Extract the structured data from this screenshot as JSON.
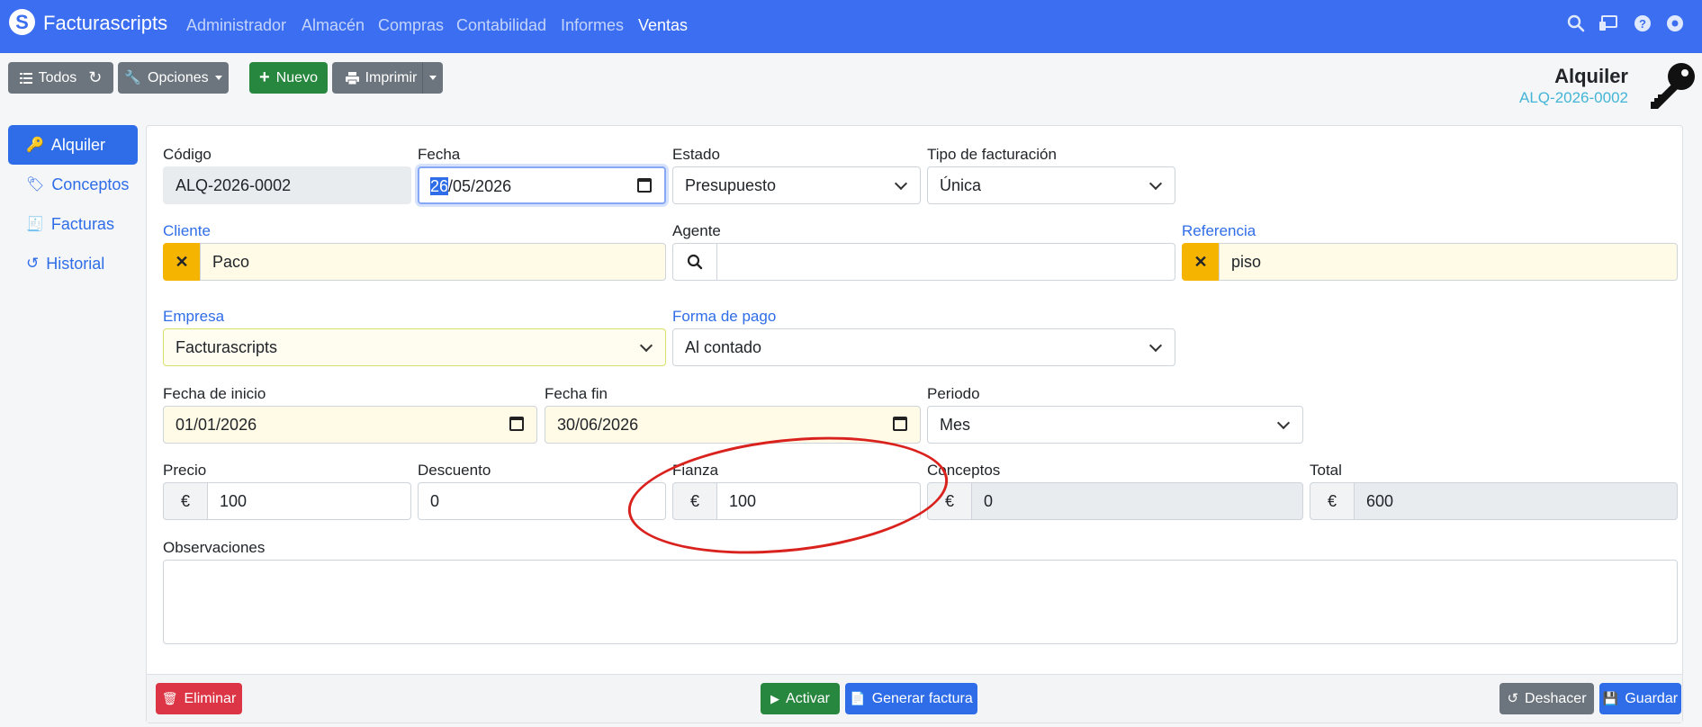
{
  "navbar": {
    "brand": "Facturascripts",
    "menu": [
      "Administrador",
      "Almacén",
      "Compras",
      "Contabilidad",
      "Informes",
      "Ventas"
    ],
    "active_menu": "Ventas",
    "icons": [
      "search-icon",
      "monitor-icon",
      "help-icon",
      "settings-icon"
    ]
  },
  "toolbar": {
    "todos_label": "Todos",
    "opciones_label": "Opciones",
    "nuevo_label": "Nuevo",
    "imprimir_label": "Imprimir"
  },
  "header": {
    "title": "Alquiler",
    "code": "ALQ-2026-0002",
    "icon": "key-icon"
  },
  "tabs": [
    {
      "label": "Alquiler",
      "icon": "key-icon",
      "active": true
    },
    {
      "label": "Conceptos",
      "icon": "tags-icon",
      "active": false
    },
    {
      "label": "Facturas",
      "icon": "invoice-icon",
      "active": false
    },
    {
      "label": "Historial",
      "icon": "history-icon",
      "active": false
    }
  ],
  "form": {
    "codigo": {
      "label": "Código",
      "value": "ALQ-2026-0002"
    },
    "fecha": {
      "label": "Fecha",
      "day_selected": "26",
      "rest": "/05/2026"
    },
    "estado": {
      "label": "Estado",
      "value": "Presupuesto"
    },
    "tipo_facturacion": {
      "label": "Tipo de facturación",
      "value": "Única"
    },
    "cliente": {
      "label": "Cliente",
      "value": "Paco"
    },
    "agente": {
      "label": "Agente",
      "value": ""
    },
    "referencia": {
      "label": "Referencia",
      "value": "piso"
    },
    "empresa": {
      "label": "Empresa",
      "value": "Facturascripts"
    },
    "forma_pago": {
      "label": "Forma de pago",
      "value": "Al contado"
    },
    "fecha_inicio": {
      "label": "Fecha de inicio",
      "value": "01/01/2026"
    },
    "fecha_fin": {
      "label": "Fecha fin",
      "value": "30/06/2026"
    },
    "periodo": {
      "label": "Periodo",
      "value": "Mes"
    },
    "precio": {
      "label": "Precio",
      "value": "100",
      "addon": "€"
    },
    "descuento": {
      "label": "Descuento",
      "value": "0"
    },
    "fianza": {
      "label": "Fianza",
      "value": "100",
      "addon": "€"
    },
    "conceptos": {
      "label": "Conceptos",
      "value": "0",
      "addon": "€"
    },
    "total": {
      "label": "Total",
      "value": "600",
      "addon": "€"
    },
    "observaciones": {
      "label": "Observaciones",
      "value": ""
    }
  },
  "footer": {
    "eliminar_label": "Eliminar",
    "activar_label": "Activar",
    "generar_factura_label": "Generar factura",
    "deshacer_label": "Deshacer",
    "guardar_label": "Guardar"
  },
  "colors": {
    "navbar": "#3b6ef0",
    "primary": "#2f6de8",
    "success": "#28873f",
    "danger": "#dc3545",
    "secondary": "#6c757d",
    "warning": "#f5b400",
    "annotation": "#d9221e"
  }
}
